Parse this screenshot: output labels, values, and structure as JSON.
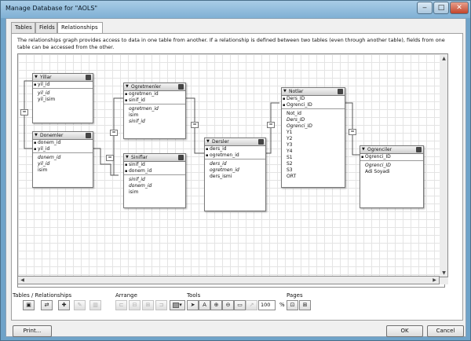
{
  "window": {
    "title": "Manage Database for \"AOLS\"",
    "minimize_icon": "minimize-icon",
    "maximize_icon": "maximize-icon",
    "close_icon": "close-icon"
  },
  "tabs": [
    {
      "label": "Tables",
      "active": false
    },
    {
      "label": "Fields",
      "active": false
    },
    {
      "label": "Relationships",
      "active": true
    }
  ],
  "description": "The relationships graph provides access to data in one table from another. If a relationship is defined between two tables (even through another table), fields from one table can be accessed from the other.",
  "tables": {
    "yillar": {
      "name": "Yillar",
      "keys": [
        "yil_id"
      ],
      "fields": [
        "yil_id",
        "yil_isim"
      ],
      "italic": [
        true,
        false
      ]
    },
    "donemler": {
      "name": "Donemler",
      "keys": [
        "donem_id",
        "yil_id"
      ],
      "fields": [
        "donem_id",
        "yil_id",
        "isim"
      ],
      "italic": [
        true,
        true,
        false
      ]
    },
    "ogretmenler": {
      "name": "Ogretmenler",
      "keys": [
        "ogretmen_id",
        "sinif_id"
      ],
      "fields": [
        "ogretmen_id",
        "isim",
        "sinif_id"
      ],
      "italic": [
        true,
        false,
        true
      ]
    },
    "siniflar": {
      "name": "Siniflar",
      "keys": [
        "sinif_id",
        "donem_id"
      ],
      "fields": [
        "sinif_id",
        "donem_id",
        "isim"
      ],
      "italic": [
        true,
        true,
        false
      ]
    },
    "dersler": {
      "name": "Dersler",
      "keys": [
        "ders_id",
        "ogretmen_id"
      ],
      "fields": [
        "ders_id",
        "ogretmen_id",
        "ders_ismi"
      ],
      "italic": [
        true,
        true,
        false
      ]
    },
    "notlar": {
      "name": "Notlar",
      "keys": [
        "Ders_ID",
        "Ogrenci_ID"
      ],
      "fields": [
        "Not_id",
        "Ders_ID",
        "Ogrenci_ID",
        "Y1",
        "Y2",
        "Y3",
        "Y4",
        "S1",
        "S2",
        "S3",
        "ORT"
      ],
      "italic": [
        false,
        true,
        true,
        false,
        false,
        false,
        false,
        false,
        false,
        false,
        false
      ]
    },
    "ogrenciler": {
      "name": "Ogrenciler",
      "keys": [
        "Ogrenci_ID"
      ],
      "fields": [
        "Ogrenci_ID",
        "Adi Soyadi"
      ],
      "italic": [
        true,
        false
      ]
    }
  },
  "toolbar": {
    "tables_label": "Tables / Relationships",
    "arrange_label": "Arrange",
    "tools_label": "Tools",
    "pages_label": "Pages",
    "zoom_value": "100",
    "zoom_unit": "%",
    "icons": {
      "add_table": "add-table-icon",
      "add_relationship": "add-relationship-icon",
      "duplicate": "duplicate-icon",
      "edit": "edit-icon",
      "delete": "delete-icon",
      "align_left": "align-left-icon",
      "align_center": "align-center-icon",
      "distribute": "distribute-icon",
      "resize": "resize-icon",
      "color": "color-swatch-icon",
      "pointer": "pointer-icon",
      "text": "text-tool-icon",
      "zoom_in": "zoom-in-icon",
      "zoom_out": "zoom-out-icon",
      "zoom_fit": "zoom-fit-icon",
      "note": "note-icon",
      "page_setup": "page-setup-icon",
      "page_breaks": "page-breaks-icon"
    }
  },
  "buttons": {
    "print": "Print...",
    "ok": "OK",
    "cancel": "Cancel"
  }
}
